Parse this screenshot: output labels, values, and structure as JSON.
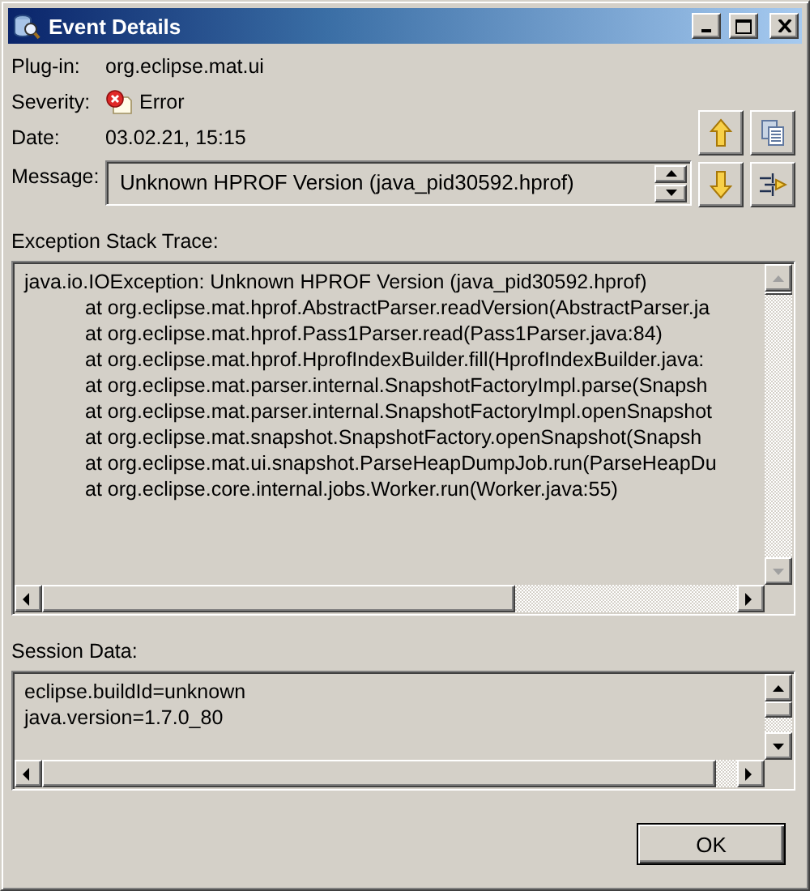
{
  "window": {
    "title": "Event Details"
  },
  "plug_in": {
    "label": "Plug-in:",
    "value": "org.eclipse.mat.ui"
  },
  "severity": {
    "label": "Severity:",
    "value": "Error"
  },
  "date": {
    "label": "Date:",
    "value": "03.02.21, 15:15"
  },
  "message": {
    "label": "Message:",
    "value": "Unknown HPROF Version (java_pid30592.hprof)"
  },
  "exception_stack_trace": {
    "label": "Exception Stack Trace:",
    "lines": [
      "java.io.IOException: Unknown HPROF Version (java_pid30592.hprof)",
      "\tat org.eclipse.mat.hprof.AbstractParser.readVersion(AbstractParser.ja",
      "\tat org.eclipse.mat.hprof.Pass1Parser.read(Pass1Parser.java:84)",
      "\tat org.eclipse.mat.hprof.HprofIndexBuilder.fill(HprofIndexBuilder.java:",
      "\tat org.eclipse.mat.parser.internal.SnapshotFactoryImpl.parse(Snapsh",
      "\tat org.eclipse.mat.parser.internal.SnapshotFactoryImpl.openSnapshot",
      "\tat org.eclipse.mat.snapshot.SnapshotFactory.openSnapshot(Snapsh",
      "\tat org.eclipse.mat.ui.snapshot.ParseHeapDumpJob.run(ParseHeapDu",
      "\tat org.eclipse.core.internal.jobs.Worker.run(Worker.java:55)"
    ]
  },
  "session_data": {
    "label": "Session Data:",
    "lines": [
      "eclipse.buildId=unknown",
      "java.version=1.7.0_80"
    ]
  },
  "buttons": [
    {
      "label": "OK"
    }
  ]
}
